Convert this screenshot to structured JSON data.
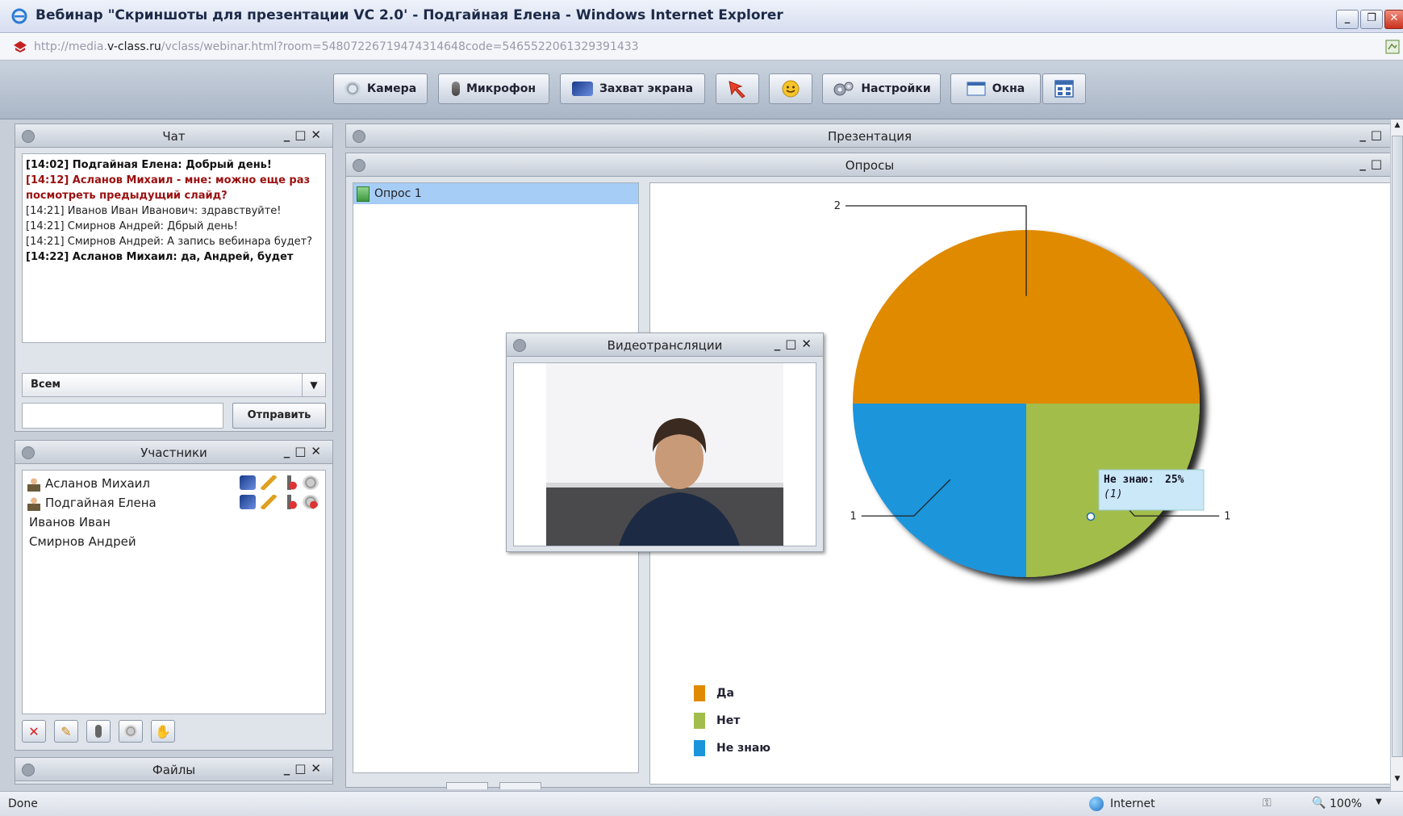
{
  "window": {
    "title": "Вебинар \"Скриншоты для презентации VC 2.0' - Подгайная Елена - Windows Internet Explorer",
    "url_prefix": "http://media.",
    "url_domain": "v-class.ru",
    "url_rest": "/vclass/webinar.html?room=54807226719474314648code=5465522061329391433"
  },
  "toolbar": {
    "camera": "Камера",
    "microphone": "Микрофон",
    "screen_capture": "Захват экрана",
    "settings": "Настройки",
    "windows": "Окна"
  },
  "chat": {
    "title": "Чат",
    "messages": [
      {
        "text": "[14:02] Подгайная Елена: Добрый день!",
        "style": "bold"
      },
      {
        "text": "[14:12] Асланов Михаил - мне: можно еще раз посмотреть предыдущий слайд?",
        "style": "red"
      },
      {
        "text": "[14:21] Иванов Иван Иванович: здравствуйте!",
        "style": "normal"
      },
      {
        "text": "[14:21] Смирнов Андрей: Дбрый день!",
        "style": "normal"
      },
      {
        "text": "[14:21] Смирнов Андрей: А запись вебинара будет?",
        "style": "normal"
      },
      {
        "text": "[14:22] Асланов Михаил: да, Андрей, будет",
        "style": "bold"
      }
    ],
    "recipient": "Всем",
    "input_value": "",
    "send": "Отправить"
  },
  "participants": {
    "title": "Участники",
    "list": [
      {
        "name": "Асланов Михаил",
        "has_icon": true
      },
      {
        "name": "Подгайная Елена",
        "has_icon": true
      },
      {
        "name": "Иванов Иван",
        "has_icon": false
      },
      {
        "name": "Смирнов Андрей",
        "has_icon": false
      }
    ]
  },
  "files": {
    "title": "Файлы"
  },
  "presentation": {
    "title": "Презентация"
  },
  "polls": {
    "title": "Опросы",
    "items": [
      "Опрос 1"
    ]
  },
  "video": {
    "title": "Видеотрансляции"
  },
  "chart_data": {
    "type": "pie",
    "categories": [
      "Да",
      "Нет",
      "Не знаю"
    ],
    "values": [
      2,
      1,
      1
    ],
    "colors": [
      "#e08a00",
      "#a3bd4c",
      "#1a95db"
    ],
    "tooltip": {
      "title": "Не знаю:",
      "percent": "25%",
      "count": "(1)"
    },
    "legend_position": "bottom-left"
  },
  "status": {
    "left": "Done",
    "zone": "Internet",
    "zoom": "100%"
  }
}
